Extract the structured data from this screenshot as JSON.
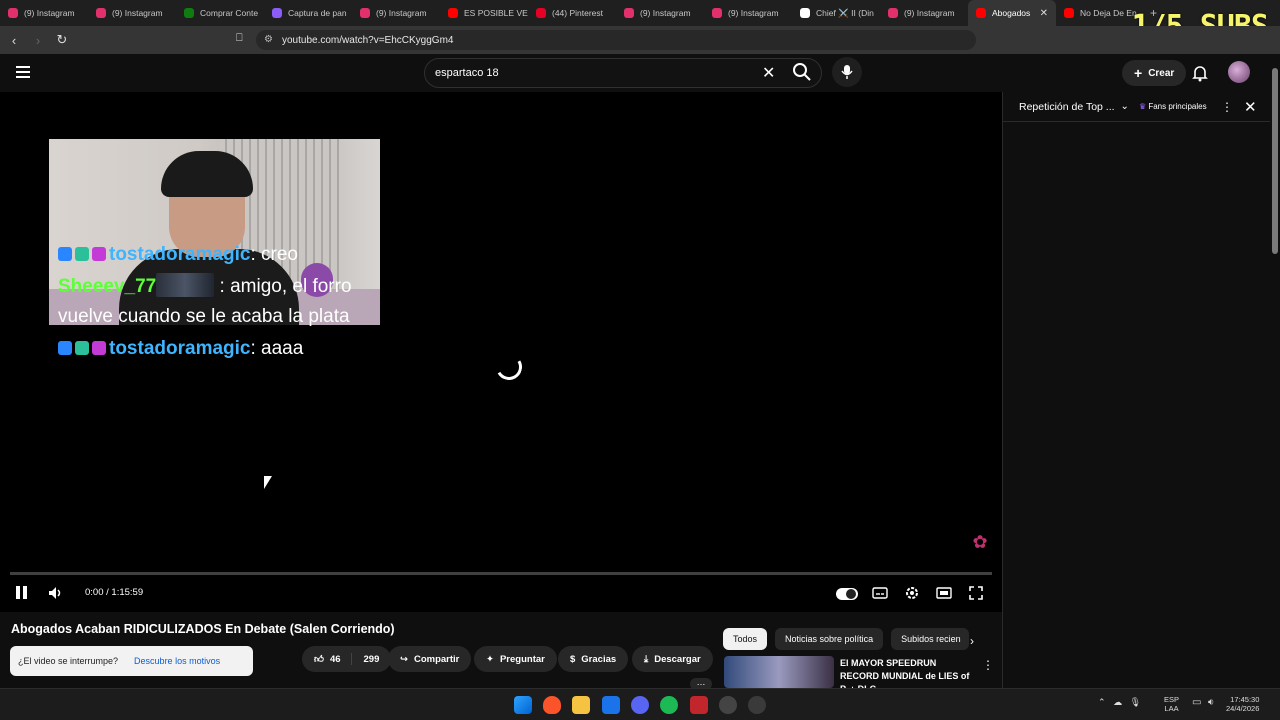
{
  "browser": {
    "tabs": [
      {
        "label": "(9) Instagram",
        "color": "#e1306c"
      },
      {
        "label": "(9) Instagram",
        "color": "#e1306c"
      },
      {
        "label": "Comprar Conte",
        "color": "#107c10"
      },
      {
        "label": "Captura de pan",
        "color": "#8b5cf6"
      },
      {
        "label": "(9) Instagram",
        "color": "#e1306c"
      },
      {
        "label": "ES POSIBLE VE",
        "color": "#ff0000"
      },
      {
        "label": "(44) Pinterest",
        "color": "#e60023"
      },
      {
        "label": "(9) Instagram",
        "color": "#e1306c"
      },
      {
        "label": "(9) Instagram",
        "color": "#e1306c"
      },
      {
        "label": "Chief ⚔️ II (Din",
        "color": "#ffffff"
      },
      {
        "label": "(9) Instagram",
        "color": "#e1306c"
      },
      {
        "label": "Abogados",
        "color": "#ff0000"
      },
      {
        "label": "No Deja De En",
        "color": "#ff0000"
      }
    ],
    "active_tab_index": 11,
    "url": "youtube.com/watch?v=EhcCKyggGm4",
    "overlay_text": "1/5 SUBS"
  },
  "youtube": {
    "search_value": "espartaco 18",
    "create_label": "Crear"
  },
  "video": {
    "chat_lines": [
      {
        "user": "tostadoramagic",
        "message": ": creo",
        "color": "#3fb4ff"
      },
      {
        "user": "Sheeev_77",
        "message": ": amigo, el forro vuelve cuando se le acaba la plata",
        "color": "#5dff38"
      },
      {
        "user": "tostadoramagic",
        "message": ": aaaa",
        "color": "#3fb4ff"
      }
    ],
    "time_display": "0:00 / 1:15:59",
    "progress_fraction": 0,
    "title": "Abogados Acaban RIDICULIZADOS En Debate (Salen Corriendo)"
  },
  "live_chat": {
    "title": "Repetición de Top ...",
    "filter_label": "Fans principales"
  },
  "actions": {
    "interrupt_question": "¿El video se interrumpe?",
    "interrupt_link": "Descubre los motivos",
    "likes": "46",
    "dislikes": "299",
    "share": "Compartir",
    "ask": "Preguntar",
    "thanks": "Gracias",
    "download": "Descargar"
  },
  "recommendations": {
    "chips": [
      "Todos",
      "Noticias sobre política",
      "Subidos recien"
    ],
    "first_title": "El MAYOR SPEEDRUN RECORD MUNDIAL de LIES of P. + DLC ..."
  },
  "taskbar": {
    "lang_top": "ESP",
    "lang_bottom": "LAA",
    "time": "17:45:30",
    "date": "24/4/2026"
  }
}
